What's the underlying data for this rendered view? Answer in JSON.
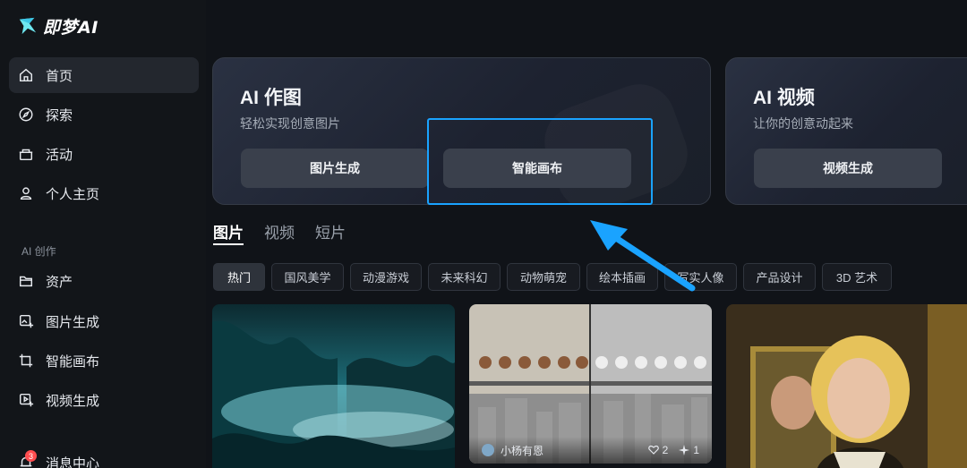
{
  "app": {
    "name": "即梦AI",
    "accent": "#1aa3ff"
  },
  "sidebar": {
    "items": [
      {
        "label": "首页",
        "icon": "home-icon"
      },
      {
        "label": "探索",
        "icon": "compass-icon"
      },
      {
        "label": "活动",
        "icon": "gift-icon"
      },
      {
        "label": "个人主页",
        "icon": "user-icon"
      }
    ],
    "section_label": "AI 创作",
    "create_items": [
      {
        "label": "资产",
        "icon": "folder-icon"
      },
      {
        "label": "图片生成",
        "icon": "image-plus-icon"
      },
      {
        "label": "智能画布",
        "icon": "canvas-crop-icon"
      },
      {
        "label": "视频生成",
        "icon": "video-plus-icon"
      },
      {
        "label": "消息中心",
        "icon": "bell-icon",
        "badge": "3"
      }
    ]
  },
  "cards": {
    "image": {
      "title": "AI 作图",
      "subtitle": "轻松实现创意图片",
      "buttons": [
        "图片生成",
        "智能画布"
      ]
    },
    "video": {
      "title": "AI 视频",
      "subtitle": "让你的创意动起来",
      "button": "视频生成"
    }
  },
  "tabs": [
    "图片",
    "视频",
    "短片"
  ],
  "categories": [
    "热门",
    "国风美学",
    "动漫游戏",
    "未来科幻",
    "动物萌宠",
    "绘本插画",
    "写实人像",
    "产品设计",
    "3D 艺术"
  ],
  "gallery": {
    "item2": {
      "author": "小杨有恩",
      "likes": "2",
      "remixes": "1"
    }
  }
}
